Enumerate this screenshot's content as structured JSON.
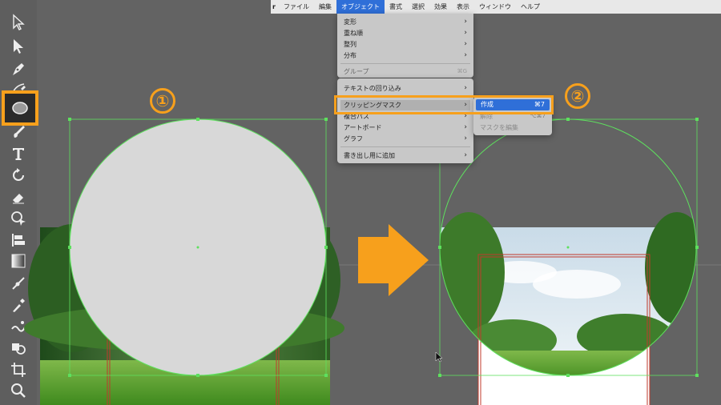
{
  "menubar": {
    "apple": "r",
    "items": [
      "ファイル",
      "編集",
      "オブジェクト",
      "書式",
      "選択",
      "効果",
      "表示",
      "ウィンドウ",
      "ヘルプ"
    ],
    "active_index": 2
  },
  "object_menu": {
    "top_items": [
      {
        "label": "変形",
        "arrow": "›"
      },
      {
        "label": "重ね順",
        "arrow": "›"
      },
      {
        "label": "整列",
        "arrow": "›"
      },
      {
        "label": "分布",
        "arrow": "›"
      },
      {
        "label": "グループ",
        "shortcut": "⌘G"
      }
    ],
    "items": [
      {
        "label": "テキストの回り込み",
        "arrow": "›"
      },
      {
        "label": "クリッピングマスク",
        "arrow": "›"
      },
      {
        "label": "複合パス",
        "arrow": "›"
      },
      {
        "label": "アートボード",
        "arrow": "›"
      },
      {
        "label": "グラフ",
        "arrow": "›"
      },
      {
        "label": "書き出し用に追加",
        "arrow": "›"
      }
    ]
  },
  "clipping_submenu": {
    "items": [
      {
        "label": "作成",
        "shortcut": "⌘7"
      },
      {
        "label": "解除",
        "shortcut": "⌥⌘7"
      },
      {
        "label": "マスクを編集"
      }
    ]
  },
  "steps": {
    "one": "①",
    "two": "②"
  },
  "colors": {
    "accent": "#f7a01c",
    "selection": "#2f6fd8",
    "guide": "#5ee05e",
    "artboard_red": "#c0392b"
  }
}
